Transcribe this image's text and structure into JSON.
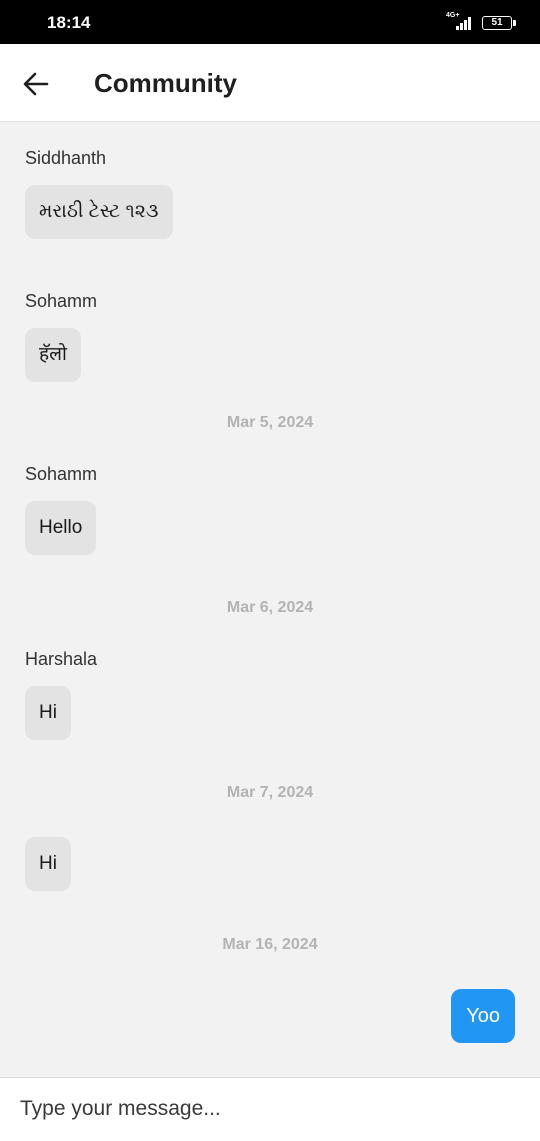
{
  "status_bar": {
    "time": "18:14",
    "network": "4G+",
    "battery": "51"
  },
  "header": {
    "back_icon": "arrow-left-icon",
    "title": "Community"
  },
  "messages": [
    {
      "sender": "Siddhanth",
      "text": "મરાઠી ટેસ્ટ ૧૨૩"
    },
    {
      "sender": "Sohamm",
      "text": "हॅलो"
    },
    {
      "date": "Mar 5, 2024"
    },
    {
      "sender": "Sohamm",
      "text": "Hello"
    },
    {
      "date": "Mar 6, 2024"
    },
    {
      "sender": "Harshala",
      "text": "Hi"
    },
    {
      "date": "Mar 7, 2024"
    },
    {
      "sender": "",
      "text": "Hi"
    },
    {
      "date": "Mar 16, 2024"
    },
    {
      "text": "Yoo",
      "mine": true
    }
  ],
  "composer": {
    "placeholder": "Type your message..."
  },
  "colors": {
    "sent_bubble": "#2196f3",
    "received_bubble": "#e3e3e3",
    "chat_background": "#f2f2f2"
  }
}
